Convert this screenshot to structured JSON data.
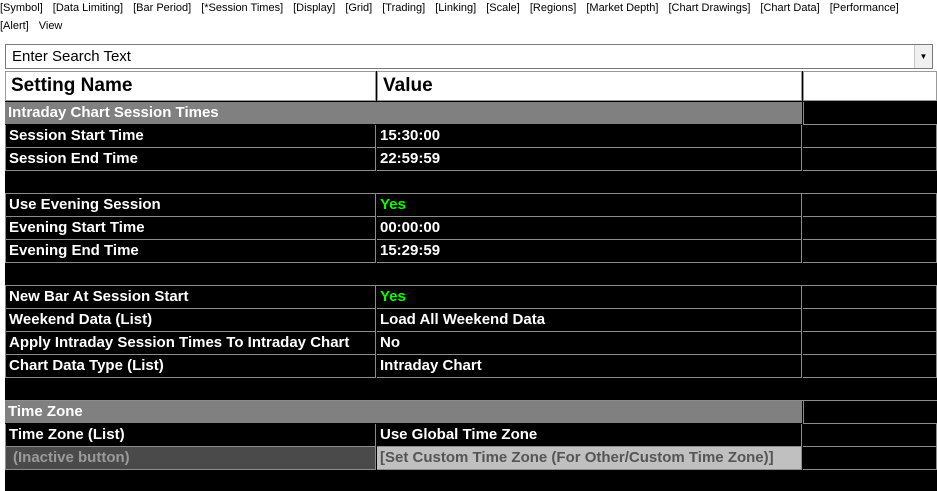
{
  "menu": {
    "line1": [
      "[Symbol]",
      "[Data Limiting]",
      "[Bar Period]",
      "[*Session Times]",
      "[Display]",
      "[Grid]",
      "[Trading]",
      "[Linking]",
      "[Scale]",
      "[Regions]",
      "[Market Depth]",
      "[Chart Drawings]",
      "[Chart Data]",
      "[Performance]"
    ],
    "line2": [
      "[Alert]",
      "View"
    ]
  },
  "search": {
    "placeholder": "Enter Search Text"
  },
  "grid": {
    "col_setting_name": "Setting Name",
    "col_value": "Value",
    "sections": {
      "intraday": "Intraday Chart Session Times",
      "timezone": "Time Zone"
    },
    "rows": {
      "session_start": {
        "name": "Session Start Time",
        "value": "15:30:00"
      },
      "session_end": {
        "name": "Session End Time",
        "value": "22:59:59"
      },
      "use_evening": {
        "name": "Use Evening Session",
        "value": "Yes"
      },
      "evening_start": {
        "name": "Evening Start Time",
        "value": "00:00:00"
      },
      "evening_end": {
        "name": "Evening End Time",
        "value": "15:29:59"
      },
      "new_bar": {
        "name": "New Bar At Session Start",
        "value": "Yes"
      },
      "weekend": {
        "name": "Weekend Data (List)",
        "value": "Load All Weekend Data"
      },
      "apply_intraday": {
        "name": "Apply Intraday Session Times To Intraday Chart",
        "value": "No"
      },
      "chart_type": {
        "name": "Chart Data Type (List)",
        "value": "Intraday Chart"
      },
      "tz_list": {
        "name": "Time Zone (List)",
        "value": "Use Global Time Zone"
      },
      "inactive": {
        "name": "(Inactive button)",
        "value": "[Set Custom Time Zone (For Other/Custom Time Zone)]"
      }
    }
  },
  "colors": {
    "yes_green": "#00ff00",
    "section_gray": "#808080",
    "grid_bg": "#000000"
  }
}
